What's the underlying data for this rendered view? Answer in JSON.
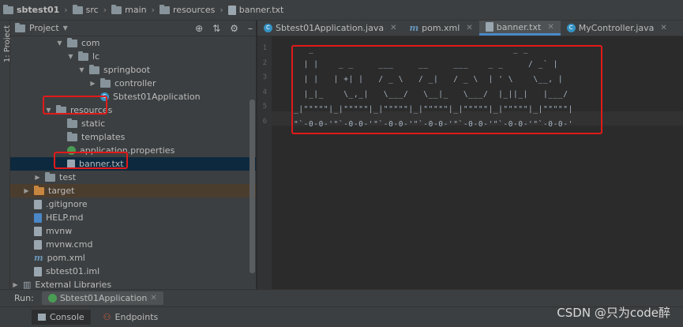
{
  "breadcrumb": [
    "sbtest01",
    "src",
    "main",
    "resources",
    "banner.txt"
  ],
  "sidebar_label": "1: Project",
  "project_panel": {
    "title": "Project",
    "tree": [
      {
        "label": "com",
        "icon": "folder",
        "indent": 4,
        "arrow": "down"
      },
      {
        "label": "lc",
        "icon": "folder",
        "indent": 5,
        "arrow": "down"
      },
      {
        "label": "springboot",
        "icon": "folder",
        "indent": 6,
        "arrow": "down"
      },
      {
        "label": "controller",
        "icon": "folder",
        "indent": 7,
        "arrow": "right"
      },
      {
        "label": "Sbtest01Application",
        "icon": "class",
        "indent": 7,
        "arrow": ""
      },
      {
        "label": "resources",
        "icon": "folder",
        "indent": 3,
        "arrow": "down"
      },
      {
        "label": "static",
        "icon": "folder",
        "indent": 4,
        "arrow": ""
      },
      {
        "label": "templates",
        "icon": "folder",
        "indent": 4,
        "arrow": ""
      },
      {
        "label": "application.properties",
        "icon": "properties",
        "indent": 4,
        "arrow": ""
      },
      {
        "label": "banner.txt",
        "icon": "text",
        "indent": 4,
        "arrow": "",
        "selected": true
      },
      {
        "label": "test",
        "icon": "folder",
        "indent": 2,
        "arrow": "right"
      },
      {
        "label": "target",
        "icon": "folder-orange",
        "indent": 1,
        "arrow": "right",
        "highlight": true
      },
      {
        "label": ".gitignore",
        "icon": "file",
        "indent": 1,
        "arrow": ""
      },
      {
        "label": "HELP.md",
        "icon": "md",
        "indent": 1,
        "arrow": ""
      },
      {
        "label": "mvnw",
        "icon": "file",
        "indent": 1,
        "arrow": ""
      },
      {
        "label": "mvnw.cmd",
        "icon": "file",
        "indent": 1,
        "arrow": ""
      },
      {
        "label": "pom.xml",
        "icon": "maven",
        "indent": 1,
        "arrow": ""
      },
      {
        "label": "sbtest01.iml",
        "icon": "file",
        "indent": 1,
        "arrow": ""
      },
      {
        "label": "External Libraries",
        "icon": "library",
        "indent": 0,
        "arrow": "right"
      }
    ]
  },
  "tabs": [
    {
      "label": "Sbtest01Application.java",
      "icon": "class",
      "active": false
    },
    {
      "label": "pom.xml",
      "icon": "maven",
      "active": false
    },
    {
      "label": "banner.txt",
      "icon": "text",
      "active": true
    },
    {
      "label": "MyController.java",
      "icon": "class",
      "active": false
    }
  ],
  "line_numbers": [
    "1",
    "2",
    "3",
    "4",
    "5",
    "6"
  ],
  "code_lines": [
    "   _                                        _ _",
    "  | |    _ _     ___     __     ___    _ _     / _` |",
    "  | |   | +| |   / _ \\   / _|   / _ \\  | ' \\    \\__, |",
    "  |_|_    \\_,_|   \\___/   \\__|_   \\___/  |_||_|   |___/",
    "_|\"\"\"\"\"|_|\"\"\"\"\"|_|\"\"\"\"\"|_|\"\"\"\"\"|_|\"\"\"\"\"|_|\"\"\"\"\"|_|\"\"\"\"\"|",
    "\"`-0-0-'\"`-0-0-'\"`-0-0-'\"`-0-0-'\"`-0-0-'\"`-0-0-'\"`-0-0-'"
  ],
  "run_bar": {
    "label": "Run:",
    "config": "Sbtest01Application"
  },
  "bottom_tabs": [
    "Console",
    "Endpoints"
  ],
  "watermark": "CSDN @只为code醉",
  "colors": {
    "highlight_box": "#e11a1a",
    "selected_row": "#0d293e",
    "accent": "#4a88c7"
  }
}
